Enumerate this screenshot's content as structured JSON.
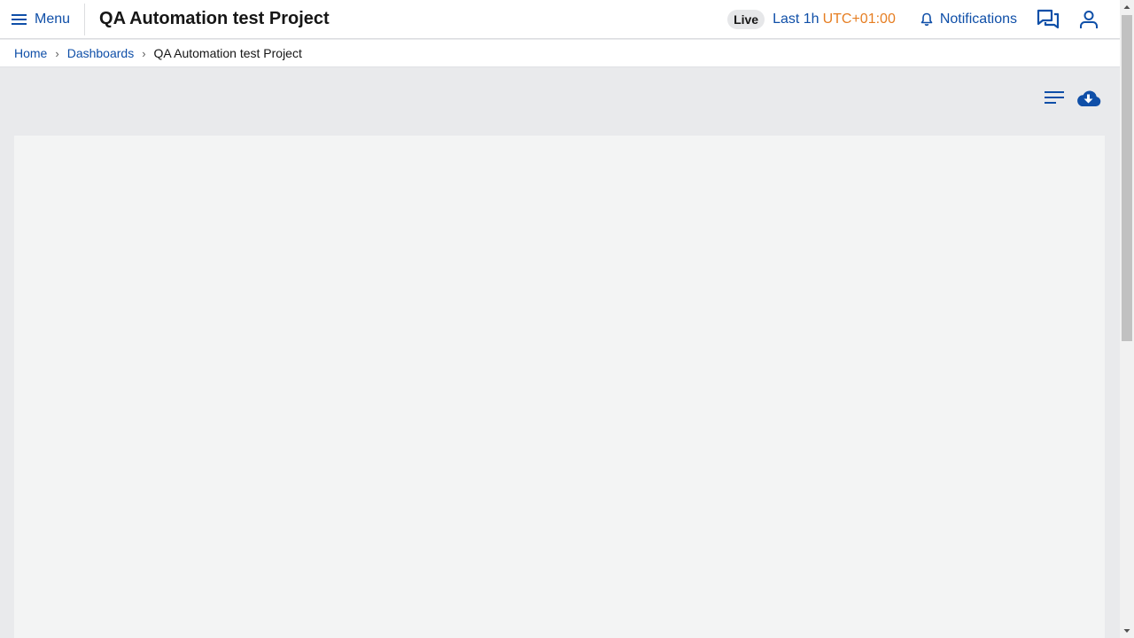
{
  "header": {
    "menu_label": "Menu",
    "title": "QA Automation test Project",
    "live_label": "Live",
    "time_range": "Last 1h",
    "timezone": "UTC+01:00",
    "notifications_label": "Notifications",
    "icons": [
      "menu-icon",
      "bell-icon",
      "chat-icon",
      "user-icon"
    ]
  },
  "breadcrumb": {
    "items": [
      "Home",
      "Dashboards"
    ],
    "current": "QA Automation test Project",
    "separator": "›"
  },
  "toolbar": {
    "icons": [
      "list-icon",
      "cloud-download-icon"
    ]
  },
  "colors": {
    "accent": "#0f4fa8",
    "timezone": "#e67e22",
    "background": "#e9eaec",
    "panel": "#f3f4f4"
  }
}
